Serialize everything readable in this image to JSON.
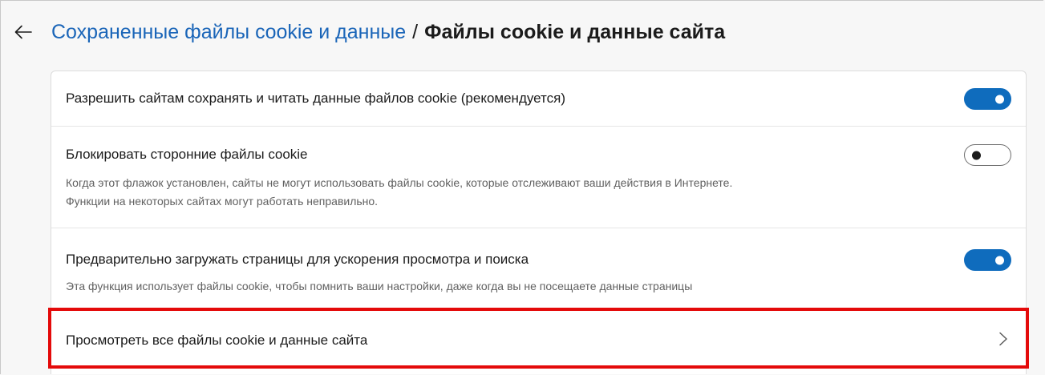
{
  "breadcrumb": {
    "back_icon": "arrow-left-icon",
    "parent": "Сохраненные файлы cookie и данные",
    "separator": "/",
    "current": "Файлы cookie и данные сайта"
  },
  "colors": {
    "link": "#1a65b8",
    "toggle_on": "#0f6cbd",
    "highlight": "#e40a0a"
  },
  "settings": [
    {
      "title": "Разрешить сайтам сохранять и читать данные файлов cookie (рекомендуется)",
      "toggle": "on"
    },
    {
      "title": "Блокировать сторонние файлы cookie",
      "desc_line1": "Когда этот флажок установлен, сайты не могут использовать файлы cookie, которые отслеживают ваши действия в Интернете.",
      "desc_line2": "Функции на некоторых сайтах могут работать неправильно.",
      "toggle": "off"
    },
    {
      "title": "Предварительно загружать страницы для ускорения просмотра и поиска",
      "desc_line1": "Эта функция использует файлы cookie, чтобы помнить ваши настройки, даже когда вы не посещаете данные страницы",
      "toggle": "on"
    },
    {
      "title": "Просмотреть все файлы cookie и данные сайта",
      "icon": "chevron-right-icon",
      "highlighted": true
    }
  ]
}
